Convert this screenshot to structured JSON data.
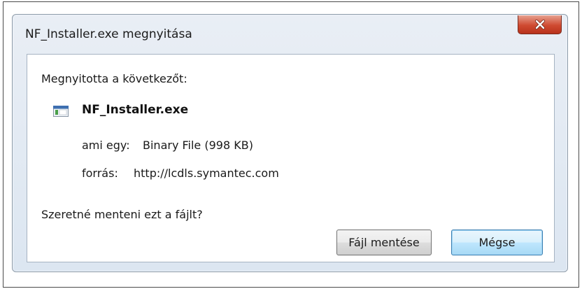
{
  "window": {
    "title": "NF_Installer.exe megnyitása",
    "close_icon": "close-x-icon"
  },
  "body": {
    "prompt": "Megnyitotta a következőt:",
    "file": {
      "icon": "executable-file-icon",
      "name": "NF_Installer.exe"
    },
    "details": {
      "type_label": "ami egy:",
      "type_value": "Binary File (998 KB)",
      "source_label": "forrás:",
      "source_value": "http://lcdls.symantec.com"
    },
    "question": "Szeretné menteni ezt a fájlt?"
  },
  "buttons": {
    "save_label": "Fájl mentése",
    "cancel_label": "Mégse"
  },
  "colors": {
    "close_button": "#cf4a31",
    "default_button_border": "#3c7fb1",
    "dialog_frame": "#dce6f1"
  }
}
